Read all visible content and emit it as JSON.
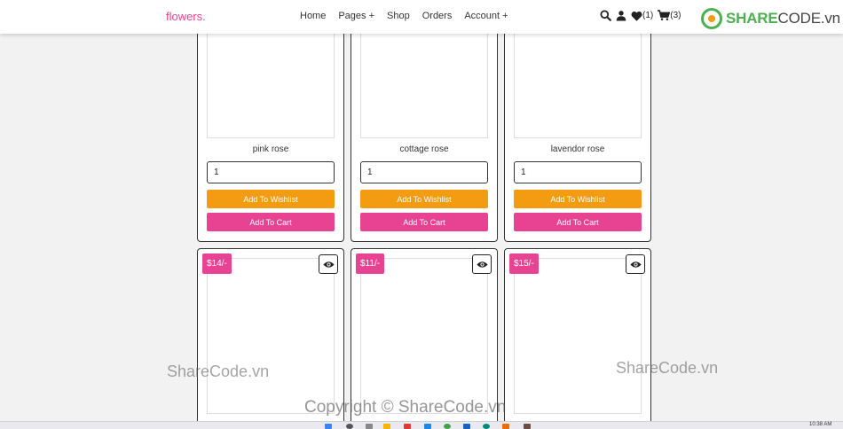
{
  "header": {
    "logo": "flowers.",
    "nav": [
      "Home",
      "Pages +",
      "Shop",
      "Orders",
      "Account +"
    ],
    "wishlist_count": "(1)",
    "cart_count": "(3)"
  },
  "brand_watermark": {
    "share": "SHARE",
    "code": "CODE.vn"
  },
  "top_products": [
    {
      "name": "pink rose",
      "qty": "1",
      "wishlist_label": "Add To Wishlist",
      "cart_label": "Add To Cart"
    },
    {
      "name": "cottage rose",
      "qty": "1",
      "wishlist_label": "Add To Wishlist",
      "cart_label": "Add To Cart"
    },
    {
      "name": "lavendor rose",
      "qty": "1",
      "wishlist_label": "Add To Wishlist",
      "cart_label": "Add To Cart"
    }
  ],
  "bottom_products": [
    {
      "price": "$14/-"
    },
    {
      "price": "$11/-"
    },
    {
      "price": "$15/-"
    }
  ],
  "watermarks": {
    "left": "ShareCode.vn",
    "right": "ShareCode.vn",
    "copyright": "Copyright © ShareCode.vn"
  },
  "taskbar": {
    "clock": "10:38 AM"
  },
  "colors": {
    "accent": "#e84393",
    "wishlist": "#f39c12",
    "brand_green": "#4caf50"
  }
}
